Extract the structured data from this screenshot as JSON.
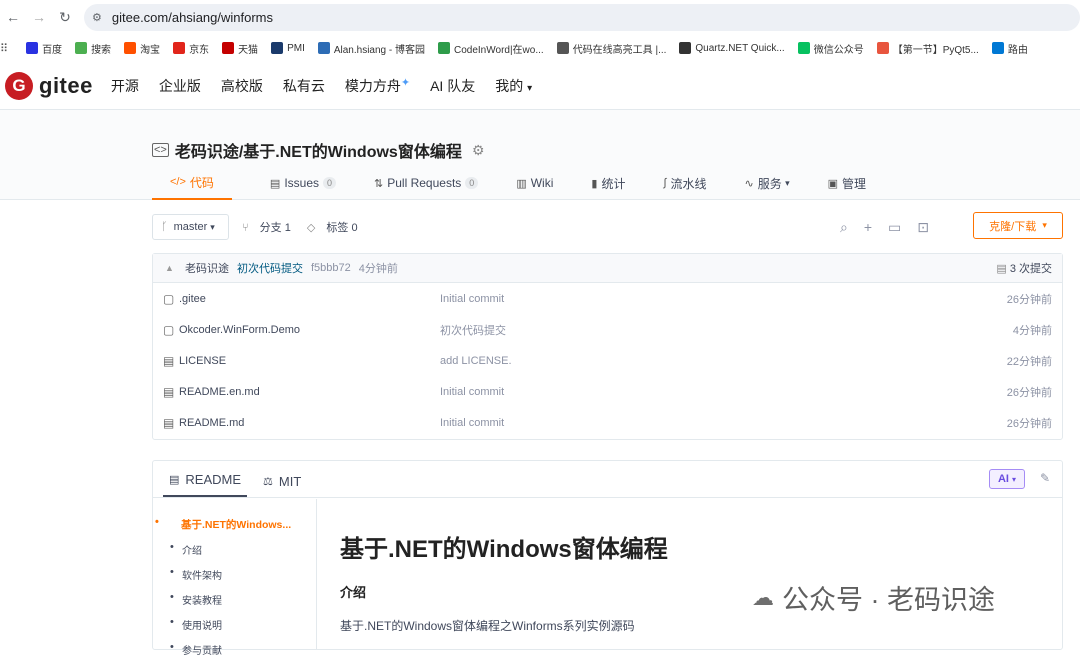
{
  "browser": {
    "back_icon": "arrow-left-icon",
    "forward_icon": "arrow-right-icon",
    "reload_icon": "reload-icon",
    "url": "gitee.com/ahsiang/winforms",
    "bookmarks": [
      {
        "label": "百度",
        "icon": "baidu-icon",
        "color": "#2932e1"
      },
      {
        "label": "搜索",
        "icon": "search-engine-icon",
        "color": "#4caf50"
      },
      {
        "label": "淘宝",
        "icon": "taobao-icon",
        "color": "#ff5000"
      },
      {
        "label": "京东",
        "icon": "jd-icon",
        "color": "#e1251b"
      },
      {
        "label": "天猫",
        "icon": "tmall-icon",
        "color": "#c40000"
      },
      {
        "label": "PMI",
        "icon": "pmi-icon",
        "color": "#1a3a6b"
      },
      {
        "label": "Alan.hsiang - 博客园",
        "icon": "cnblogs-icon",
        "color": "#2d6cb5"
      },
      {
        "label": "CodeInWord|在wo...",
        "icon": "codeinword-icon",
        "color": "#2e9c4a"
      },
      {
        "label": "代码在线高亮工具 |...",
        "icon": "highlight-icon",
        "color": "#555555"
      },
      {
        "label": "Quartz.NET Quick...",
        "icon": "quartz-icon",
        "color": "#333333"
      },
      {
        "label": "微信公众号",
        "icon": "wechat-icon",
        "color": "#07c160"
      },
      {
        "label": "【第一节】PyQt5...",
        "icon": "gift-icon",
        "color": "#e8553e"
      },
      {
        "label": "路由",
        "icon": "windows-icon",
        "color": "#0078d4"
      }
    ]
  },
  "header": {
    "logo_letter": "G",
    "logo_text": "gitee",
    "nav": [
      "开源",
      "企业版",
      "高校版",
      "私有云",
      "模力方舟",
      "AI 队友",
      "我的"
    ],
    "spark": "✦",
    "my_caret": "▾"
  },
  "project": {
    "title": "老码识途/基于.NET的Windows窗体编程",
    "tabs": [
      {
        "label": "代码",
        "icon": "</>"
      },
      {
        "label": "Issues",
        "icon": "▤",
        "count": "0"
      },
      {
        "label": "Pull Requests",
        "icon": "⇅",
        "count": "0"
      },
      {
        "label": "Wiki",
        "icon": "▥"
      },
      {
        "label": "统计",
        "icon": "▮"
      },
      {
        "label": "流水线",
        "icon": "∫"
      },
      {
        "label": "服务",
        "icon": "∿",
        "caret": "▾"
      },
      {
        "label": "管理",
        "icon": "▣"
      }
    ]
  },
  "branch": {
    "name": "master",
    "caret": "▾",
    "branches": "分支 1",
    "tags": "标签 0",
    "clone_label": "克隆/下载"
  },
  "commit": {
    "author": "老码识途",
    "message": "初次代码提交",
    "sha": "f5bbb72",
    "time": "4分钟前",
    "total": "3 次提交"
  },
  "files": [
    {
      "name": ".gitee",
      "type": "folder",
      "message": "Initial commit",
      "time": "26分钟前"
    },
    {
      "name": "Okcoder.WinForm.Demo",
      "type": "folder",
      "message": "初次代码提交",
      "time": "4分钟前"
    },
    {
      "name": "LICENSE",
      "type": "file",
      "message": "add LICENSE.",
      "time": "22分钟前"
    },
    {
      "name": "README.en.md",
      "type": "file",
      "message": "Initial commit",
      "time": "26分钟前"
    },
    {
      "name": "README.md",
      "type": "file",
      "message": "Initial commit",
      "time": "26分钟前"
    }
  ],
  "readme": {
    "tabs": [
      "README",
      "MIT"
    ],
    "ai_label": "AI",
    "toc": [
      "基于.NET的Windows...",
      "介绍",
      "软件架构",
      "安装教程",
      "使用说明",
      "参与贡献"
    ],
    "h1": "基于.NET的Windows窗体编程",
    "h2": "介绍",
    "p": "基于.NET的Windows窗体编程之Winforms系列实例源码"
  },
  "watermark": "公众号 · 老码识途"
}
